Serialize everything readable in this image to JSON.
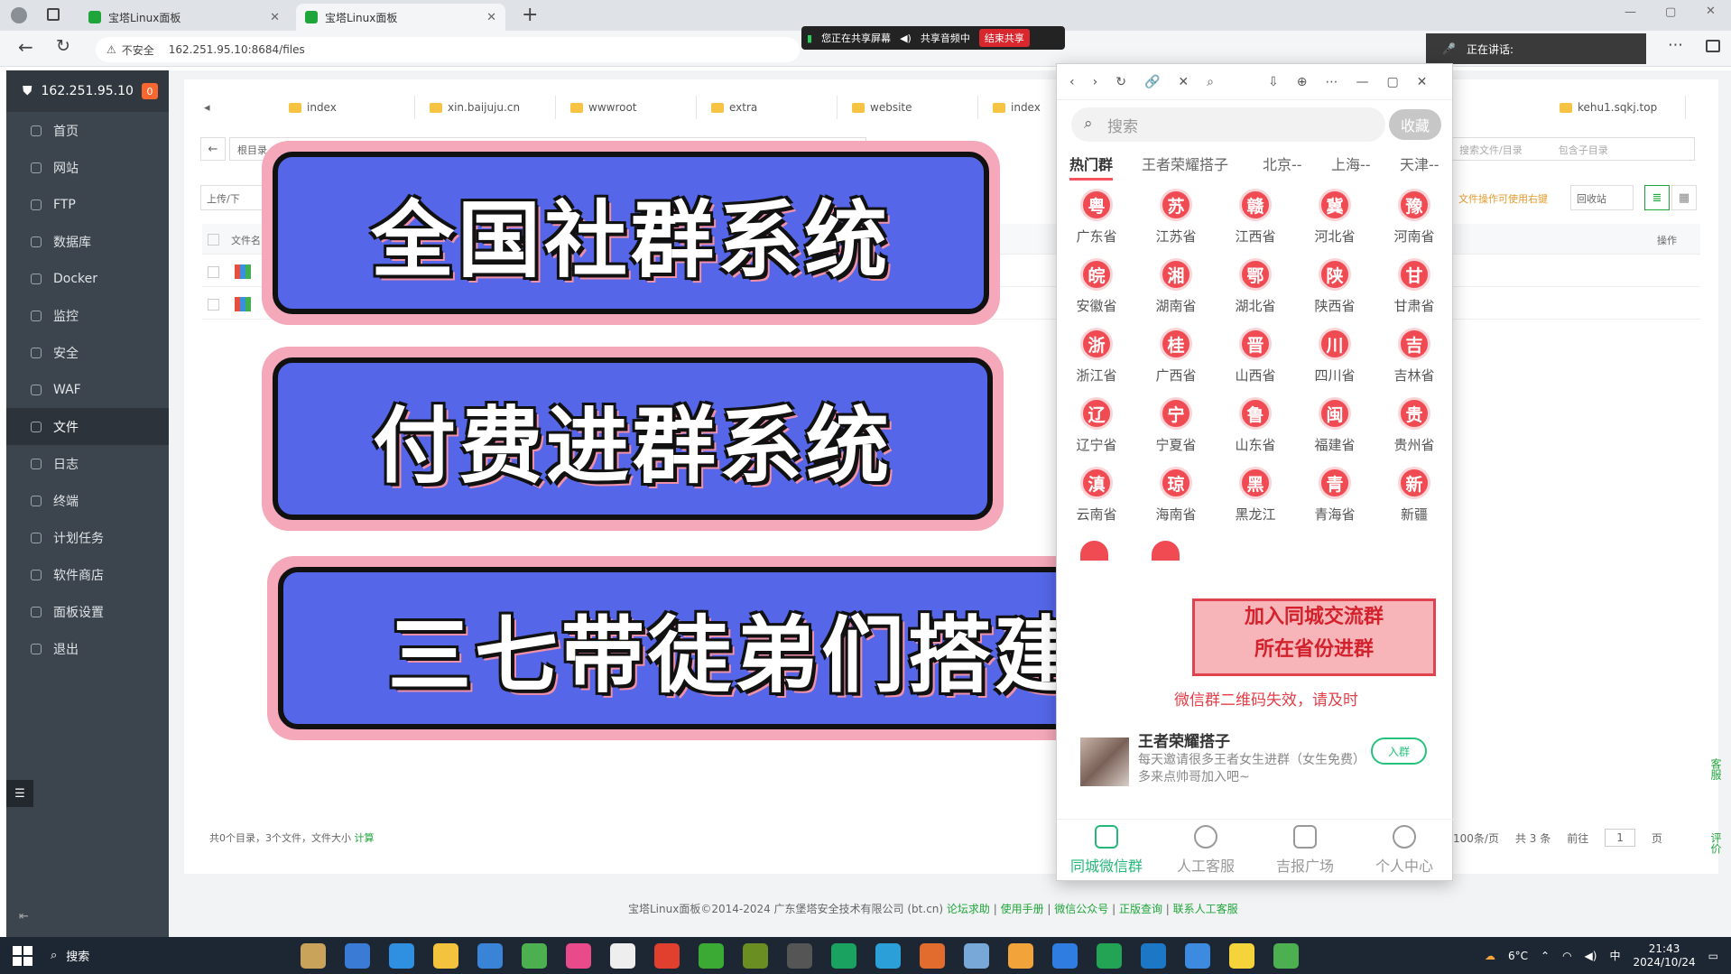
{
  "browser": {
    "tabs": [
      {
        "label": "宝塔Linux面板"
      },
      {
        "label": "宝塔Linux面板"
      }
    ],
    "warning": "不安全",
    "url": "162.251.95.10:8684/files",
    "share": {
      "screen": "您正在共享屏幕",
      "audio": "共享音频中",
      "stop": "结束共享"
    },
    "speaking": "正在讲话:"
  },
  "sidebar": {
    "ip": "162.251.95.10",
    "badge": "0",
    "items": [
      "首页",
      "网站",
      "FTP",
      "数据库",
      "Docker",
      "监控",
      "安全",
      "WAF",
      "文件",
      "日志",
      "终端",
      "计划任务",
      "软件商店",
      "面板设置",
      "退出"
    ],
    "active": "文件"
  },
  "files": {
    "tabs": [
      "index",
      "xin.baijuju.cn",
      "wwwroot",
      "extra",
      "website",
      "index",
      "kehu1.sqkj.top"
    ],
    "root": "根目录",
    "upload": "上传/下",
    "actions": {
      "recycle": "回收站",
      "hint": "文件操作可使用右键",
      "op": "操作",
      "search": "搜索文件/目录",
      "include": "包含子目录"
    },
    "header": "文件名",
    "status": "共0个目录，3个文件，文件大小",
    "calc": "计算",
    "pager": {
      "per": "100条/页",
      "total": "共 3 条",
      "goto": "前往",
      "page": "1",
      "unit": "页"
    }
  },
  "banners": [
    "全国社群系统",
    "付费进群系统",
    "三七带徒弟们搭建"
  ],
  "phone": {
    "search": "搜索",
    "fav": "收藏",
    "tabs": [
      "热门群",
      "王者荣耀搭子",
      "北京--",
      "上海--",
      "天津--"
    ],
    "provinces": [
      {
        "c": "粤",
        "n": "广东省"
      },
      {
        "c": "苏",
        "n": "江苏省"
      },
      {
        "c": "赣",
        "n": "江西省"
      },
      {
        "c": "冀",
        "n": "河北省"
      },
      {
        "c": "豫",
        "n": "河南省"
      },
      {
        "c": "皖",
        "n": "安徽省"
      },
      {
        "c": "湘",
        "n": "湖南省"
      },
      {
        "c": "鄂",
        "n": "湖北省"
      },
      {
        "c": "陕",
        "n": "陕西省"
      },
      {
        "c": "甘",
        "n": "甘肃省"
      },
      {
        "c": "浙",
        "n": "浙江省"
      },
      {
        "c": "桂",
        "n": "广西省"
      },
      {
        "c": "晋",
        "n": "山西省"
      },
      {
        "c": "川",
        "n": "四川省"
      },
      {
        "c": "吉",
        "n": "吉林省"
      },
      {
        "c": "辽",
        "n": "辽宁省"
      },
      {
        "c": "宁",
        "n": "宁夏省"
      },
      {
        "c": "鲁",
        "n": "山东省"
      },
      {
        "c": "闽",
        "n": "福建省"
      },
      {
        "c": "贵",
        "n": "贵州省"
      },
      {
        "c": "滇",
        "n": "云南省"
      },
      {
        "c": "琼",
        "n": "海南省"
      },
      {
        "c": "黑",
        "n": "黑龙江"
      },
      {
        "c": "青",
        "n": "青海省"
      },
      {
        "c": "新",
        "n": "新疆"
      }
    ],
    "promo": [
      "加入同城交流群",
      "所在省份进群"
    ],
    "warn": "微信群二维码失效，请及时",
    "group": {
      "title": "王者荣耀搭子",
      "desc": "每天邀请很多王者女生进群（女生免费）多来点帅哥加入吧~",
      "join": "入群"
    },
    "nav": [
      "同城微信群",
      "人工客服",
      "吉报广场",
      "个人中心"
    ]
  },
  "footer": {
    "copy": "宝塔Linux面板©2014-2024 广东堡塔安全技术有限公司 (bt.cn)",
    "links": [
      "论坛求助",
      "使用手册",
      "微信公众号",
      "正版查询",
      "联系人工客服"
    ]
  },
  "taskbar": {
    "search": "搜索",
    "weather": "6°C",
    "ime": "中",
    "time": "21:43",
    "date": "2024/10/24"
  },
  "side_widgets": {
    "service": "客服",
    "review": "评价"
  }
}
